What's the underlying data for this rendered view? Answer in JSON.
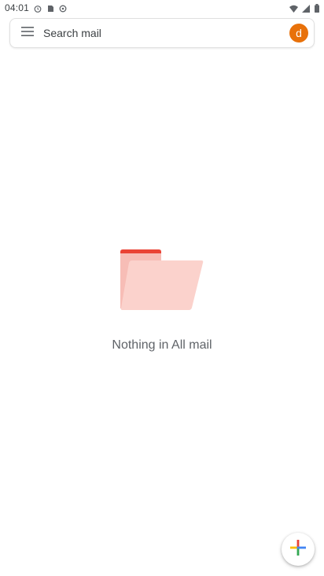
{
  "status_bar": {
    "time": "04:01",
    "left_icons": [
      "alarm-icon",
      "sd-card-icon",
      "sync-icon"
    ],
    "right_icons": [
      "wifi-icon",
      "signal-icon",
      "battery-icon"
    ]
  },
  "search": {
    "placeholder": "Search mail",
    "menu_icon": "hamburger-menu-icon",
    "avatar_letter": "d",
    "avatar_color": "#e8710a"
  },
  "empty_state": {
    "icon": "folder-icon",
    "message": "Nothing in All mail"
  },
  "fab": {
    "icon": "compose-plus-icon",
    "colors": [
      "#4285f4",
      "#ea4335",
      "#fbbc04",
      "#34a853"
    ]
  }
}
